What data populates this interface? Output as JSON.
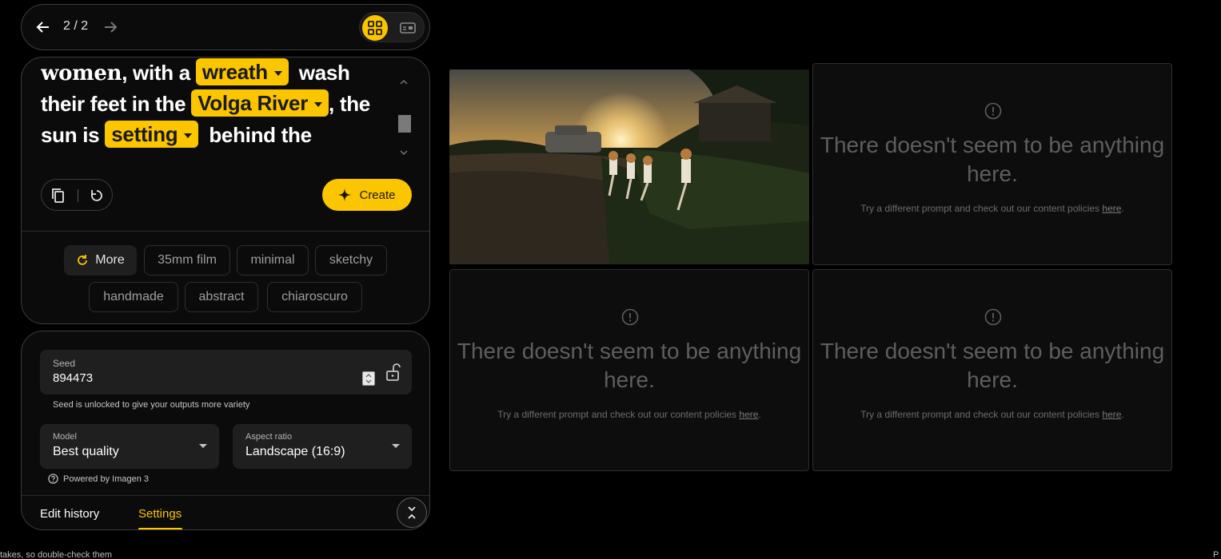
{
  "nav": {
    "counter": "2 / 2"
  },
  "prompt": {
    "line1_pre": "",
    "line1_word": "women",
    "line1_mid": ", with a ",
    "chip_wreath": "wreath",
    "line1_post": "wash",
    "line2_pre": "their feet in the ",
    "chip_river": "Volga River",
    "line2_post": ", the",
    "line3_pre": "sun is ",
    "chip_setting": "setting",
    "line3_post": "behind the"
  },
  "actions": {
    "create_label": "Create"
  },
  "styles": {
    "more_label": "More",
    "chips": [
      "35mm film",
      "minimal",
      "sketchy",
      "handmade",
      "abstract",
      "chiaroscuro"
    ]
  },
  "settings": {
    "seed_label": "Seed",
    "seed_value": "894473",
    "seed_note": "Seed is unlocked to give your outputs more variety",
    "model_label": "Model",
    "model_value": "Best quality",
    "aspect_label": "Aspect ratio",
    "aspect_value": "Landscape (16:9)",
    "powered_by": "Powered by Imagen 3",
    "tab_edit": "Edit history",
    "tab_settings": "Settings"
  },
  "empty": {
    "title": "There doesn't seem to be anything here.",
    "sub_pre": "Try a different prompt and check out our content policies ",
    "link": "here",
    "sub_post": "."
  },
  "footer": {
    "left": "takes, so double-check them",
    "right": "P"
  },
  "colors": {
    "accent": "#fbc500",
    "background": "#000000",
    "panel_border": "#3c3c3c"
  }
}
